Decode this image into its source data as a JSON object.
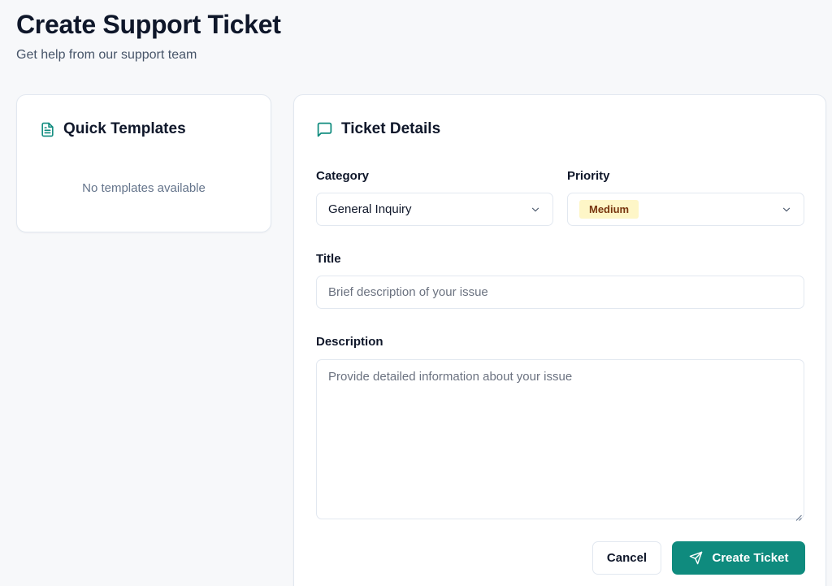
{
  "header": {
    "title": "Create Support Ticket",
    "subtitle": "Get help from our support team"
  },
  "templates": {
    "title": "Quick Templates",
    "icon": "file-text-icon",
    "empty_text": "No templates available"
  },
  "ticket": {
    "title": "Ticket Details",
    "icon": "message-square-icon",
    "category": {
      "label": "Category",
      "value": "General Inquiry"
    },
    "priority": {
      "label": "Priority",
      "value": "Medium",
      "badge_color": "#fef6c7",
      "badge_text_color": "#78350f"
    },
    "title_field": {
      "label": "Title",
      "placeholder": "Brief description of your issue",
      "value": ""
    },
    "description_field": {
      "label": "Description",
      "placeholder": "Provide detailed information about your issue",
      "value": ""
    }
  },
  "actions": {
    "cancel_label": "Cancel",
    "create_label": "Create Ticket",
    "create_icon": "send-icon"
  },
  "colors": {
    "accent": "#0f8b7e",
    "background": "#f7f8fa",
    "card": "#ffffff",
    "border": "#e2e8f0"
  }
}
